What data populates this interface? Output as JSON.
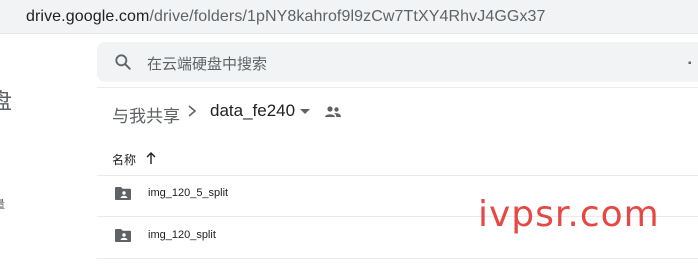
{
  "browser": {
    "url_host": "drive.google.com",
    "url_path": "/drive/folders/1pNY8kahrof9l9zCw7TtXY4RhvJ4GGx37"
  },
  "sidebar": {
    "logo_fragment": "盘",
    "item_fragment": "量"
  },
  "search": {
    "placeholder": "在云端硬盘中搜索",
    "icon": "search-icon"
  },
  "breadcrumb": {
    "root": "与我共享",
    "current": "data_fe240",
    "separator_icon": "chevron-right-icon",
    "dropdown_icon": "caret-down-icon",
    "shared_icon": "people-icon"
  },
  "list": {
    "column_name": "名称",
    "sort_icon": "arrow-up-icon",
    "rows": [
      {
        "name": "img_120_5_split",
        "icon": "shared-folder-icon"
      },
      {
        "name": "img_120_split",
        "icon": "shared-folder-icon"
      }
    ]
  },
  "watermark": "ivpsr.com",
  "colors": {
    "watermark": "#e53935",
    "search_bg": "#f1f3f4",
    "icon_gray": "#5f6368"
  }
}
